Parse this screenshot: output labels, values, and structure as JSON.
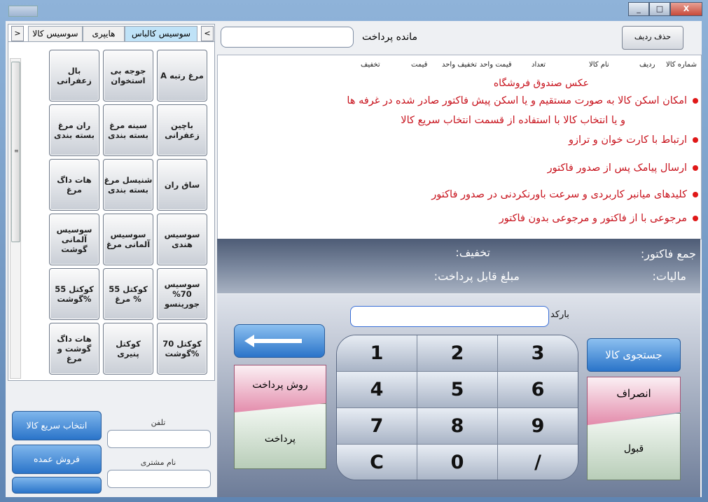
{
  "titlebar": {
    "controls": [
      "_",
      "□",
      "X"
    ]
  },
  "tabs": [
    {
      "label": "سوسیس کالباس",
      "active": true
    },
    {
      "label": "هایپری",
      "active": false
    },
    {
      "label": "سوسیس کالا",
      "active": false
    }
  ],
  "nav": {
    "prev": "<",
    "next": ">"
  },
  "products": [
    "مرغ رتبه A",
    "جوجه بی استخوان",
    "بال زعفرانی",
    "باچین زعفرانی",
    "سینه مرغ بسته بندی",
    "ران مرغ بسته بندی",
    "ساق ران",
    "شنیسل مرغ بسته بندی",
    "هات داگ مرغ",
    "سوسیس هندی",
    "سوسیس آلمانی مرغ",
    "سوسیس آلمانی گوشت",
    "سوسیس 70% جورینسو",
    "کوکتل 55 % مرغ",
    "کوکتل 55 %گوشت",
    "کوکتل 70 %گوشت",
    "کوکتل پنیری",
    "هات داگ گوشت و مرغ"
  ],
  "lower_left": {
    "quick_select": "انتخاب سریع کالا",
    "wholesale": "فروش عمده",
    "phone_label": "تلفن",
    "customer_label": "نام مشتری"
  },
  "header": {
    "delete_row": "حذف ردیف",
    "remain_label": "مانده  پرداخت"
  },
  "grid": {
    "columns": [
      "ردیف",
      "شماره کالا",
      "نام کالا",
      "تعداد",
      "قیمت واحد",
      "تخفیف واحد",
      "قیمت",
      "تخفیف"
    ],
    "promo_title": "عکس صندوق فروشگاه",
    "promo_lines": [
      "امکان اسکن کالا به صورت مستقیم و یا اسکن پیش فاکتور صادر شده در غرفه ها",
      "و یا انتخاب کالا با استفاده از قسمت انتخاب سریع کالا",
      "ارتباط با کارت خوان و ترازو",
      "ارسال پیامک پس از صدور فاکتور",
      "کلیدهای میانبر کاربردی و سرعت باورنکردنی در صدور فاکتور",
      "مرجوعی با از فاکتور و مرجوعی بدون فاکتور"
    ]
  },
  "totals": {
    "invoice_total": "جمع فاکتور:",
    "discount": "تخفیف:",
    "tax": "مالیات:",
    "payable": "مبلغ قابل پرداخت:"
  },
  "bottom": {
    "barcode_label": "بارکد",
    "pay_method": "روش پرداخت",
    "pay": "پرداخت",
    "search_product": "جستجوی کالا",
    "cancel": "انصراف",
    "accept": "قبول"
  },
  "keypad": [
    "1",
    "2",
    "3",
    "4",
    "5",
    "6",
    "7",
    "8",
    "9",
    "C",
    "0",
    "/"
  ]
}
